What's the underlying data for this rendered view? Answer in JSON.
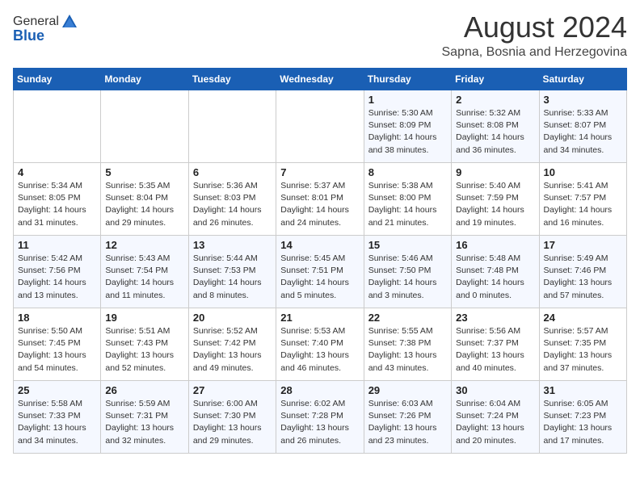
{
  "header": {
    "logo_general": "General",
    "logo_blue": "Blue",
    "month_year": "August 2024",
    "location": "Sapna, Bosnia and Herzegovina"
  },
  "weekdays": [
    "Sunday",
    "Monday",
    "Tuesday",
    "Wednesday",
    "Thursday",
    "Friday",
    "Saturday"
  ],
  "weeks": [
    [
      {
        "day": "",
        "info": ""
      },
      {
        "day": "",
        "info": ""
      },
      {
        "day": "",
        "info": ""
      },
      {
        "day": "",
        "info": ""
      },
      {
        "day": "1",
        "info": "Sunrise: 5:30 AM\nSunset: 8:09 PM\nDaylight: 14 hours\nand 38 minutes."
      },
      {
        "day": "2",
        "info": "Sunrise: 5:32 AM\nSunset: 8:08 PM\nDaylight: 14 hours\nand 36 minutes."
      },
      {
        "day": "3",
        "info": "Sunrise: 5:33 AM\nSunset: 8:07 PM\nDaylight: 14 hours\nand 34 minutes."
      }
    ],
    [
      {
        "day": "4",
        "info": "Sunrise: 5:34 AM\nSunset: 8:05 PM\nDaylight: 14 hours\nand 31 minutes."
      },
      {
        "day": "5",
        "info": "Sunrise: 5:35 AM\nSunset: 8:04 PM\nDaylight: 14 hours\nand 29 minutes."
      },
      {
        "day": "6",
        "info": "Sunrise: 5:36 AM\nSunset: 8:03 PM\nDaylight: 14 hours\nand 26 minutes."
      },
      {
        "day": "7",
        "info": "Sunrise: 5:37 AM\nSunset: 8:01 PM\nDaylight: 14 hours\nand 24 minutes."
      },
      {
        "day": "8",
        "info": "Sunrise: 5:38 AM\nSunset: 8:00 PM\nDaylight: 14 hours\nand 21 minutes."
      },
      {
        "day": "9",
        "info": "Sunrise: 5:40 AM\nSunset: 7:59 PM\nDaylight: 14 hours\nand 19 minutes."
      },
      {
        "day": "10",
        "info": "Sunrise: 5:41 AM\nSunset: 7:57 PM\nDaylight: 14 hours\nand 16 minutes."
      }
    ],
    [
      {
        "day": "11",
        "info": "Sunrise: 5:42 AM\nSunset: 7:56 PM\nDaylight: 14 hours\nand 13 minutes."
      },
      {
        "day": "12",
        "info": "Sunrise: 5:43 AM\nSunset: 7:54 PM\nDaylight: 14 hours\nand 11 minutes."
      },
      {
        "day": "13",
        "info": "Sunrise: 5:44 AM\nSunset: 7:53 PM\nDaylight: 14 hours\nand 8 minutes."
      },
      {
        "day": "14",
        "info": "Sunrise: 5:45 AM\nSunset: 7:51 PM\nDaylight: 14 hours\nand 5 minutes."
      },
      {
        "day": "15",
        "info": "Sunrise: 5:46 AM\nSunset: 7:50 PM\nDaylight: 14 hours\nand 3 minutes."
      },
      {
        "day": "16",
        "info": "Sunrise: 5:48 AM\nSunset: 7:48 PM\nDaylight: 14 hours\nand 0 minutes."
      },
      {
        "day": "17",
        "info": "Sunrise: 5:49 AM\nSunset: 7:46 PM\nDaylight: 13 hours\nand 57 minutes."
      }
    ],
    [
      {
        "day": "18",
        "info": "Sunrise: 5:50 AM\nSunset: 7:45 PM\nDaylight: 13 hours\nand 54 minutes."
      },
      {
        "day": "19",
        "info": "Sunrise: 5:51 AM\nSunset: 7:43 PM\nDaylight: 13 hours\nand 52 minutes."
      },
      {
        "day": "20",
        "info": "Sunrise: 5:52 AM\nSunset: 7:42 PM\nDaylight: 13 hours\nand 49 minutes."
      },
      {
        "day": "21",
        "info": "Sunrise: 5:53 AM\nSunset: 7:40 PM\nDaylight: 13 hours\nand 46 minutes."
      },
      {
        "day": "22",
        "info": "Sunrise: 5:55 AM\nSunset: 7:38 PM\nDaylight: 13 hours\nand 43 minutes."
      },
      {
        "day": "23",
        "info": "Sunrise: 5:56 AM\nSunset: 7:37 PM\nDaylight: 13 hours\nand 40 minutes."
      },
      {
        "day": "24",
        "info": "Sunrise: 5:57 AM\nSunset: 7:35 PM\nDaylight: 13 hours\nand 37 minutes."
      }
    ],
    [
      {
        "day": "25",
        "info": "Sunrise: 5:58 AM\nSunset: 7:33 PM\nDaylight: 13 hours\nand 34 minutes."
      },
      {
        "day": "26",
        "info": "Sunrise: 5:59 AM\nSunset: 7:31 PM\nDaylight: 13 hours\nand 32 minutes."
      },
      {
        "day": "27",
        "info": "Sunrise: 6:00 AM\nSunset: 7:30 PM\nDaylight: 13 hours\nand 29 minutes."
      },
      {
        "day": "28",
        "info": "Sunrise: 6:02 AM\nSunset: 7:28 PM\nDaylight: 13 hours\nand 26 minutes."
      },
      {
        "day": "29",
        "info": "Sunrise: 6:03 AM\nSunset: 7:26 PM\nDaylight: 13 hours\nand 23 minutes."
      },
      {
        "day": "30",
        "info": "Sunrise: 6:04 AM\nSunset: 7:24 PM\nDaylight: 13 hours\nand 20 minutes."
      },
      {
        "day": "31",
        "info": "Sunrise: 6:05 AM\nSunset: 7:23 PM\nDaylight: 13 hours\nand 17 minutes."
      }
    ]
  ]
}
